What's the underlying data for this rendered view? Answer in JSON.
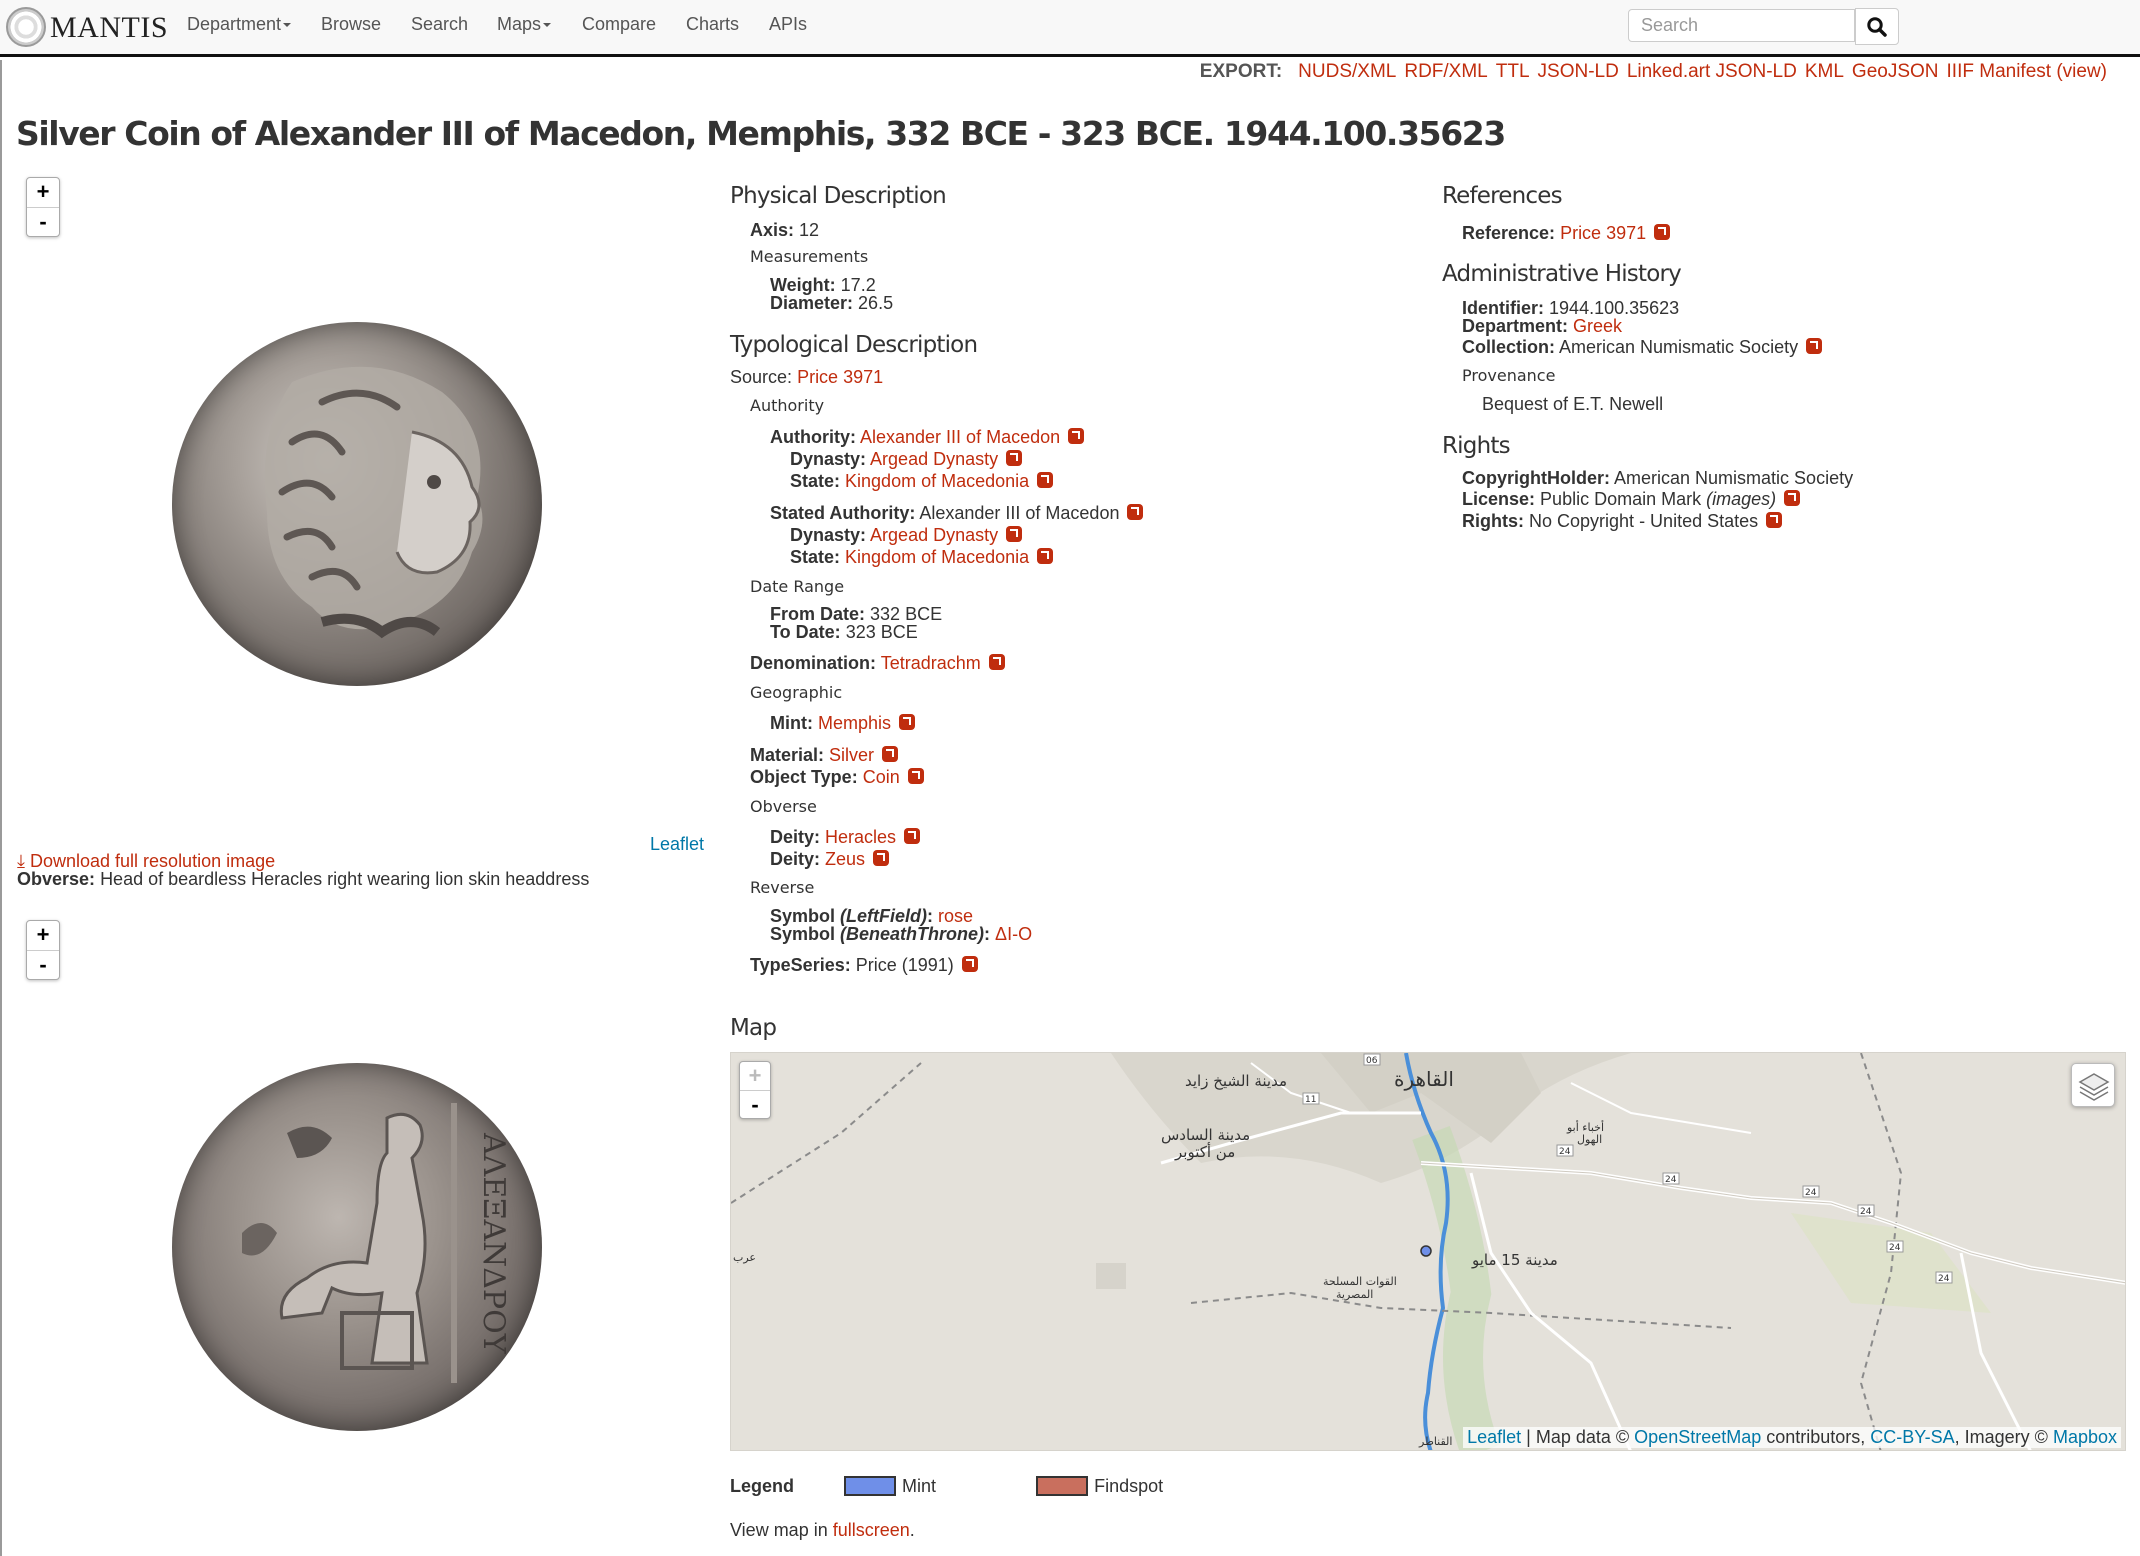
{
  "nav": {
    "logo": "MANTIS",
    "items": [
      "Department",
      "Browse",
      "Search",
      "Maps",
      "Compare",
      "Charts",
      "APIs"
    ],
    "search_placeholder": "Search"
  },
  "export": {
    "label": "EXPORT:",
    "links": [
      "NUDS/XML",
      "RDF/XML",
      "TTL",
      "JSON-LD",
      "Linked.art JSON-LD",
      "KML",
      "GeoJSON",
      "IIIF Manifest (view)"
    ]
  },
  "title": "Silver Coin of Alexander III of Macedon, Memphis, 332 BCE - 323 BCE. 1944.100.35623",
  "viewer": {
    "zoom_in": "+",
    "zoom_out": "-",
    "leaflet_label": "Leaflet",
    "download_label": "Download full resolution image",
    "obverse_label": "Obverse:",
    "obverse_text": "Head of beardless Heracles right wearing lion skin headdress",
    "reverse_legend": "ΑΛΕΞΑΝΔΡΟΥ"
  },
  "physical": {
    "heading": "Physical Description",
    "axis_label": "Axis:",
    "axis_value": "12",
    "measurements_heading": "Measurements",
    "weight_label": "Weight:",
    "weight_value": "17.2",
    "diameter_label": "Diameter:",
    "diameter_value": "26.5"
  },
  "typological": {
    "heading": "Typological Description",
    "source_label": "Source:",
    "source_value": "Price 3971",
    "authority_heading": "Authority",
    "authority_label": "Authority:",
    "authority_value": "Alexander III of Macedon",
    "dynasty_label": "Dynasty:",
    "dynasty_value": "Argead Dynasty",
    "state_label": "State:",
    "state_value": "Kingdom of Macedonia",
    "stated_authority_label": "Stated Authority:",
    "stated_authority_value": "Alexander III of Macedon",
    "date_range_heading": "Date Range",
    "from_label": "From Date:",
    "from_value": "332 BCE",
    "to_label": "To Date:",
    "to_value": "323 BCE",
    "denomination_label": "Denomination:",
    "denomination_value": "Tetradrachm",
    "geographic_heading": "Geographic",
    "mint_label": "Mint:",
    "mint_value": "Memphis",
    "material_label": "Material:",
    "material_value": "Silver",
    "object_type_label": "Object Type:",
    "object_type_value": "Coin",
    "obverse_heading": "Obverse",
    "deity_label": "Deity:",
    "deity1_value": "Heracles",
    "deity2_value": "Zeus",
    "reverse_heading": "Reverse",
    "symbol1_label": "Symbol",
    "symbol1_qualifier": "(LeftField)",
    "symbol1_value": "rose",
    "symbol2_label": "Symbol",
    "symbol2_qualifier": "(BeneathThrone)",
    "symbol2_value": "ΔI-O",
    "typeseries_label": "TypeSeries:",
    "typeseries_value": "Price (1991)"
  },
  "references": {
    "heading": "References",
    "reference_label": "Reference:",
    "reference_value": "Price 3971"
  },
  "admin": {
    "heading": "Administrative History",
    "identifier_label": "Identifier:",
    "identifier_value": "1944.100.35623",
    "department_label": "Department:",
    "department_value": "Greek",
    "collection_label": "Collection:",
    "collection_value": "American Numismatic Society",
    "provenance_heading": "Provenance",
    "provenance_value": "Bequest of E.T. Newell"
  },
  "rights": {
    "heading": "Rights",
    "holder_label": "CopyrightHolder:",
    "holder_value": "American Numismatic Society",
    "license_label": "License:",
    "license_value": "Public Domain Mark",
    "license_note": "(images)",
    "rights_label": "Rights:",
    "rights_value": "No Copyright - United States"
  },
  "map": {
    "heading": "Map",
    "zoom_in": "+",
    "zoom_out": "-",
    "place_labels": [
      "القاهرة",
      "مدينة الشيخ زايد",
      "مدينة السادس",
      "من أكتوبر",
      "مدينة 15 مايو",
      "القوات المسلحة",
      "المصرية",
      "القناطر",
      "أخباء أبو",
      "الهول",
      "عرب"
    ],
    "road_labels": [
      "24",
      "24",
      "24",
      "24",
      "24",
      "24",
      "11",
      "06"
    ],
    "attribution": {
      "leaflet": "Leaflet",
      "text1": " | Map data © ",
      "osm": "OpenStreetMap",
      "text2": " contributors, ",
      "license": "CC-BY-SA",
      "text3": ", Imagery © ",
      "mapbox": "Mapbox"
    }
  },
  "legend": {
    "heading": "Legend",
    "mint": "Mint",
    "findspot": "Findspot",
    "mint_color": "#6f8fe8",
    "findspot_color": "#c96f5e"
  },
  "fullscreen": {
    "prefix": "View map in ",
    "link": "fullscreen",
    "suffix": "."
  },
  "colors": {
    "link": "#c02d0e",
    "map_link": "#0078a8",
    "navbar_bg": "#f8f8f8"
  }
}
